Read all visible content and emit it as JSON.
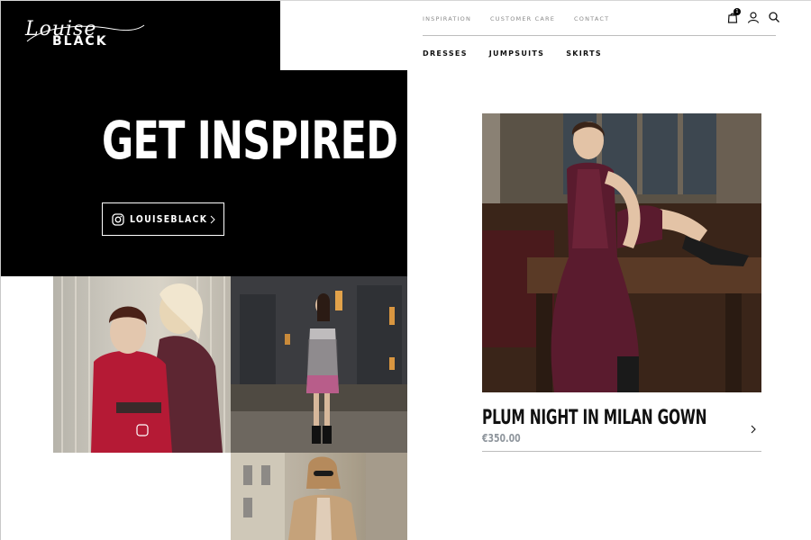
{
  "brand": {
    "script_text": "Louise",
    "bold_text": "BLACK"
  },
  "top_nav": {
    "items": [
      {
        "label": "INSPIRATION"
      },
      {
        "label": "CUSTOMER CARE"
      },
      {
        "label": "CONTACT"
      }
    ],
    "icons": [
      "bag-icon",
      "user-icon",
      "search-icon"
    ],
    "cart_count": "1"
  },
  "category_nav": {
    "items": [
      {
        "label": "DRESSES"
      },
      {
        "label": "JUMPSUITS"
      },
      {
        "label": "SKIRTS"
      }
    ]
  },
  "hero": {
    "title": "GET INSPIRED",
    "instagram_label": "LOUISEBLACK"
  },
  "product": {
    "title": "PLUM NIGHT IN MILAN GOWN",
    "price": "€350.00"
  },
  "colors": {
    "hero_bg": "#000000",
    "price": "#8f969d",
    "gown": "#5a1b2e"
  }
}
